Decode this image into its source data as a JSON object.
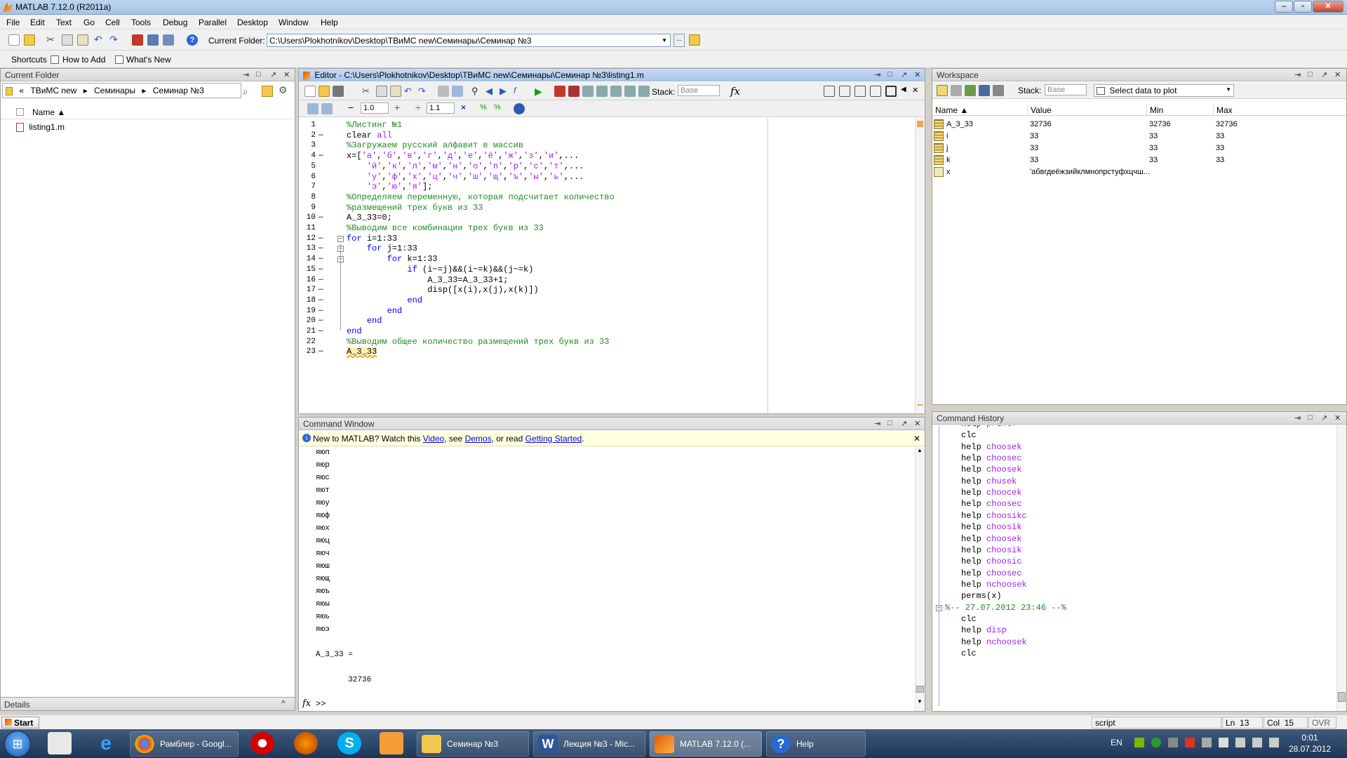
{
  "window": {
    "title": "MATLAB  7.12.0 (R2011a)"
  },
  "menu": [
    "File",
    "Edit",
    "Text",
    "Go",
    "Cell",
    "Tools",
    "Debug",
    "Parallel",
    "Desktop",
    "Window",
    "Help"
  ],
  "toolbar": {
    "current_folder_label": "Current Folder:",
    "current_folder_path": "C:\\Users\\Plokhotnikov\\Desktop\\ТВиМС new\\Семинары\\Семинар №3",
    "browse_label": "..."
  },
  "shortcuts": {
    "label": "Shortcuts",
    "how_to_add": "How to Add",
    "whats_new": "What's New"
  },
  "current_folder_panel": {
    "title": "Current Folder",
    "breadcrumb": [
      "«",
      "ТВиМС new",
      "▸",
      "Семинары",
      "▸",
      "Семинар №3"
    ],
    "col_name": "Name ▲",
    "files": [
      "listing1.m"
    ],
    "details": "Details"
  },
  "editor": {
    "title": "Editor - C:\\Users\\Plokhotnikov\\Desktop\\ТВиМС new\\Семинары\\Семинар №3\\listing1.m",
    "stack_label": "Stack:",
    "stack_value": "Base",
    "fx_label": "fx",
    "cell_step1": "1.0",
    "cell_step2": "1.1",
    "lines": [
      {
        "n": "1",
        "dash": "",
        "segs": [
          {
            "t": "%Листинг №1",
            "c": "c"
          }
        ]
      },
      {
        "n": "2",
        "dash": "—",
        "segs": [
          {
            "t": "clear ",
            "c": ""
          },
          {
            "t": "all",
            "c": "s"
          }
        ]
      },
      {
        "n": "3",
        "dash": "",
        "segs": [
          {
            "t": "%Загружаем русский алфавит в массив",
            "c": "c"
          }
        ]
      },
      {
        "n": "4",
        "dash": "—",
        "segs": [
          {
            "t": "x=[",
            "c": ""
          },
          {
            "t": "'а'",
            "c": "s"
          },
          {
            "t": ",",
            "c": ""
          },
          {
            "t": "'б'",
            "c": "s"
          },
          {
            "t": ",",
            "c": ""
          },
          {
            "t": "'в'",
            "c": "s"
          },
          {
            "t": ",",
            "c": ""
          },
          {
            "t": "'г'",
            "c": "s"
          },
          {
            "t": ",",
            "c": ""
          },
          {
            "t": "'д'",
            "c": "s"
          },
          {
            "t": ",",
            "c": ""
          },
          {
            "t": "'е'",
            "c": "s"
          },
          {
            "t": ",",
            "c": ""
          },
          {
            "t": "'ё'",
            "c": "s"
          },
          {
            "t": ",",
            "c": ""
          },
          {
            "t": "'ж'",
            "c": "s"
          },
          {
            "t": ",",
            "c": ""
          },
          {
            "t": "'з'",
            "c": "s"
          },
          {
            "t": ",",
            "c": ""
          },
          {
            "t": "'и'",
            "c": "s"
          },
          {
            "t": ",...",
            "c": ""
          }
        ]
      },
      {
        "n": "5",
        "dash": "",
        "segs": [
          {
            "t": "    ",
            "c": ""
          },
          {
            "t": "'й'",
            "c": "s"
          },
          {
            "t": ",",
            "c": ""
          },
          {
            "t": "'к'",
            "c": "s"
          },
          {
            "t": ",",
            "c": ""
          },
          {
            "t": "'л'",
            "c": "s"
          },
          {
            "t": ",",
            "c": ""
          },
          {
            "t": "'м'",
            "c": "s"
          },
          {
            "t": ",",
            "c": ""
          },
          {
            "t": "'н'",
            "c": "s"
          },
          {
            "t": ",",
            "c": ""
          },
          {
            "t": "'о'",
            "c": "s"
          },
          {
            "t": ",",
            "c": ""
          },
          {
            "t": "'п'",
            "c": "s"
          },
          {
            "t": ",",
            "c": ""
          },
          {
            "t": "'р'",
            "c": "s"
          },
          {
            "t": ",",
            "c": ""
          },
          {
            "t": "'с'",
            "c": "s"
          },
          {
            "t": ",",
            "c": ""
          },
          {
            "t": "'т'",
            "c": "s"
          },
          {
            "t": ",...",
            "c": ""
          }
        ]
      },
      {
        "n": "6",
        "dash": "",
        "segs": [
          {
            "t": "    ",
            "c": ""
          },
          {
            "t": "'у'",
            "c": "s"
          },
          {
            "t": ",",
            "c": ""
          },
          {
            "t": "'ф'",
            "c": "s"
          },
          {
            "t": ",",
            "c": ""
          },
          {
            "t": "'х'",
            "c": "s"
          },
          {
            "t": ",",
            "c": ""
          },
          {
            "t": "'ц'",
            "c": "s"
          },
          {
            "t": ",",
            "c": ""
          },
          {
            "t": "'ч'",
            "c": "s"
          },
          {
            "t": ",",
            "c": ""
          },
          {
            "t": "'ш'",
            "c": "s"
          },
          {
            "t": ",",
            "c": ""
          },
          {
            "t": "'щ'",
            "c": "s"
          },
          {
            "t": ",",
            "c": ""
          },
          {
            "t": "'ъ'",
            "c": "s"
          },
          {
            "t": ",",
            "c": ""
          },
          {
            "t": "'ы'",
            "c": "s"
          },
          {
            "t": ",",
            "c": ""
          },
          {
            "t": "'ь'",
            "c": "s"
          },
          {
            "t": ",...",
            "c": ""
          }
        ]
      },
      {
        "n": "7",
        "dash": "",
        "segs": [
          {
            "t": "    ",
            "c": ""
          },
          {
            "t": "'э'",
            "c": "s"
          },
          {
            "t": ",",
            "c": ""
          },
          {
            "t": "'ю'",
            "c": "s"
          },
          {
            "t": ",",
            "c": ""
          },
          {
            "t": "'я'",
            "c": "s"
          },
          {
            "t": "];",
            "c": ""
          }
        ]
      },
      {
        "n": "8",
        "dash": "",
        "segs": [
          {
            "t": "%Определяем переменную, которая подсчитает количество",
            "c": "c"
          }
        ]
      },
      {
        "n": "9",
        "dash": "",
        "segs": [
          {
            "t": "%размещений трех букв из 33",
            "c": "c"
          }
        ]
      },
      {
        "n": "10",
        "dash": "—",
        "segs": [
          {
            "t": "A_3_33=0;",
            "c": ""
          }
        ]
      },
      {
        "n": "11",
        "dash": "",
        "segs": [
          {
            "t": "%Выводим все комбинации трех букв из 33",
            "c": "c"
          }
        ]
      },
      {
        "n": "12",
        "dash": "—",
        "segs": [
          {
            "t": "for ",
            "c": "k"
          },
          {
            "t": "i=1:33",
            "c": ""
          }
        ]
      },
      {
        "n": "13",
        "dash": "—",
        "segs": [
          {
            "t": "    ",
            "c": ""
          },
          {
            "t": "for ",
            "c": "k"
          },
          {
            "t": "j=1:33",
            "c": ""
          }
        ]
      },
      {
        "n": "14",
        "dash": "—",
        "segs": [
          {
            "t": "        ",
            "c": ""
          },
          {
            "t": "for ",
            "c": "k"
          },
          {
            "t": "k=1:33",
            "c": ""
          }
        ]
      },
      {
        "n": "15",
        "dash": "—",
        "segs": [
          {
            "t": "            ",
            "c": ""
          },
          {
            "t": "if ",
            "c": "k"
          },
          {
            "t": "(i~=j)&&(i~=k)&&(j~=k)",
            "c": ""
          }
        ]
      },
      {
        "n": "16",
        "dash": "—",
        "segs": [
          {
            "t": "                A_3_33=A_3_33+1;",
            "c": ""
          }
        ]
      },
      {
        "n": "17",
        "dash": "—",
        "segs": [
          {
            "t": "                disp([x(i),x(j),x(k)])",
            "c": ""
          }
        ]
      },
      {
        "n": "18",
        "dash": "—",
        "segs": [
          {
            "t": "            ",
            "c": ""
          },
          {
            "t": "end",
            "c": "k"
          }
        ]
      },
      {
        "n": "19",
        "dash": "—",
        "segs": [
          {
            "t": "        ",
            "c": ""
          },
          {
            "t": "end",
            "c": "k"
          }
        ]
      },
      {
        "n": "20",
        "dash": "—",
        "segs": [
          {
            "t": "    ",
            "c": ""
          },
          {
            "t": "end",
            "c": "k"
          }
        ]
      },
      {
        "n": "21",
        "dash": "—",
        "segs": [
          {
            "t": "end",
            "c": "k"
          }
        ]
      },
      {
        "n": "22",
        "dash": "",
        "segs": [
          {
            "t": "%Выводим общее количество размещений трех букв из 33",
            "c": "c"
          }
        ]
      },
      {
        "n": "23",
        "dash": "—",
        "segs": [
          {
            "t": "A_3_33",
            "c": ""
          }
        ]
      }
    ]
  },
  "workspace": {
    "title": "Workspace",
    "stack_label": "Stack:",
    "stack_value": "Base",
    "plot_label": "Select data to plot",
    "columns": [
      "Name ▲",
      "Value",
      "Min",
      "Max"
    ],
    "rows": [
      {
        "name": "A_3_33",
        "value": "32736",
        "min": "32736",
        "max": "32736"
      },
      {
        "name": "i",
        "value": "33",
        "min": "33",
        "max": "33"
      },
      {
        "name": "j",
        "value": "33",
        "min": "33",
        "max": "33"
      },
      {
        "name": "k",
        "value": "33",
        "min": "33",
        "max": "33"
      },
      {
        "name": "x",
        "value": "'абвгдеёжзийклмнопрстуфхцчш...",
        "min": "",
        "max": ""
      }
    ]
  },
  "command_window": {
    "title": "Command Window",
    "news_prefix": "New to MATLAB? Watch this ",
    "news_video": "Video",
    "news_mid1": ", see ",
    "news_demos": "Demos",
    "news_mid2": ", or read ",
    "news_gs": "Getting Started",
    "news_end": ".",
    "output": [
      "яюп",
      "яюр",
      "яюс",
      "яют",
      "яюу",
      "яюф",
      "яюх",
      "яюц",
      "яюч",
      "яюш",
      "яющ",
      "яюъ",
      "яюы",
      "яюь",
      "яюэ",
      "",
      "A_3_33 =",
      "",
      "       32736"
    ],
    "prompt": ">>",
    "fx": "fx"
  },
  "history": {
    "title": "Command History",
    "items": [
      {
        "t": "help ",
        "arg": "printf"
      },
      {
        "t": "clc",
        "arg": ""
      },
      {
        "t": "help ",
        "arg": "choosek"
      },
      {
        "t": "help ",
        "arg": "choosec"
      },
      {
        "t": "help ",
        "arg": "choosek"
      },
      {
        "t": "help ",
        "arg": "chusek"
      },
      {
        "t": "help ",
        "arg": "choocek"
      },
      {
        "t": "help ",
        "arg": "choosec"
      },
      {
        "t": "help ",
        "arg": "choosikc"
      },
      {
        "t": "help ",
        "arg": "choosik"
      },
      {
        "t": "help ",
        "arg": "choosek"
      },
      {
        "t": "help ",
        "arg": "choosik"
      },
      {
        "t": "help ",
        "arg": "choosic"
      },
      {
        "t": "help ",
        "arg": "choosec"
      },
      {
        "t": "help ",
        "arg": "nchoosek"
      },
      {
        "t": "perms(x)",
        "arg": ""
      }
    ],
    "separator": "%-- 27.07.2012 23:46 --%",
    "items2": [
      {
        "t": "clc",
        "arg": ""
      },
      {
        "t": "help ",
        "arg": "disp"
      },
      {
        "t": "help ",
        "arg": "nchoosek"
      },
      {
        "t": "clc",
        "arg": ""
      }
    ]
  },
  "statusbar": {
    "start": "Start",
    "mode": "script",
    "ln_label": "Ln",
    "ln": "13",
    "col_label": "Col",
    "col": "15",
    "ovr": "OVR"
  },
  "taskbar": {
    "items": [
      "Рамблер - Googl...",
      "Семинар №3",
      "Лекция №3 - Mic...",
      "MATLAB  7.12.0 (...",
      "Help"
    ],
    "lang": "EN",
    "time": "0:01",
    "date": "28.07.2012"
  }
}
